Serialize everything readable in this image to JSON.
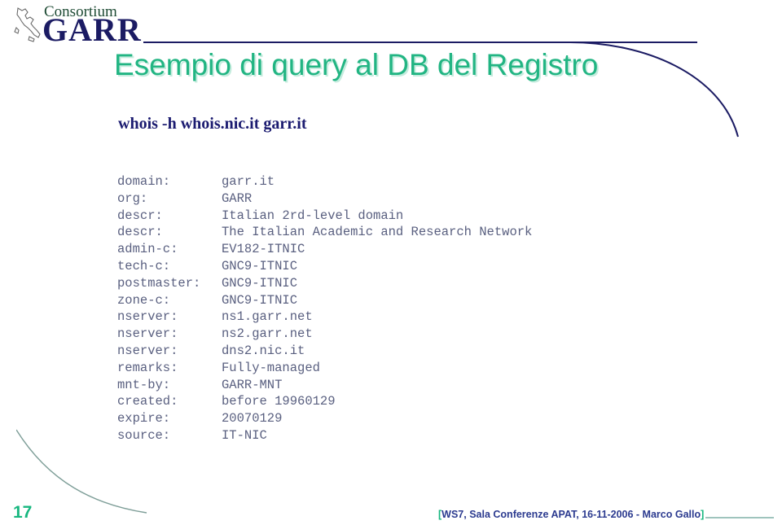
{
  "logo": {
    "map_icon": "italy-map-icon",
    "line1": "Consortium",
    "line2": "GARR",
    "green": "#1d4a33",
    "navy": "#1b1b63"
  },
  "slide": {
    "title": "Esempio di query al DB del Registro",
    "title_color": "#22b583",
    "command": "whois -h whois.nic.it garr.it",
    "command_color": "#1b1b70"
  },
  "record": {
    "text_color": "#5a6080",
    "rows": [
      {
        "key": "domain:",
        "value": "garr.it"
      },
      {
        "key": "org:",
        "value": "GARR"
      },
      {
        "key": "descr:",
        "value": "Italian 2rd-level domain"
      },
      {
        "key": "descr:",
        "value": "The Italian Academic and Research Network"
      },
      {
        "key": "admin-c:",
        "value": "EV182-ITNIC"
      },
      {
        "key": "tech-c:",
        "value": "GNC9-ITNIC"
      },
      {
        "key": "postmaster:",
        "value": "GNC9-ITNIC"
      },
      {
        "key": "zone-c:",
        "value": "GNC9-ITNIC"
      },
      {
        "key": "nserver:",
        "value": "ns1.garr.net"
      },
      {
        "key": "nserver:",
        "value": "ns2.garr.net"
      },
      {
        "key": "nserver:",
        "value": "dns2.nic.it"
      },
      {
        "key": "remarks:",
        "value": "Fully-managed"
      },
      {
        "key": "mnt-by:",
        "value": "GARR-MNT"
      },
      {
        "key": "created:",
        "value": "before 19960129"
      },
      {
        "key": "expire:",
        "value": "20070129"
      },
      {
        "key": "source:",
        "value": "IT-NIC"
      }
    ]
  },
  "footer": {
    "page_number": "17",
    "page_number_color": "#17b77f",
    "bracket_open": "[",
    "text": "WS7, Sala Conferenze APAT, 16-11-2006 - Marco Gallo",
    "bracket_close": "]",
    "text_color": "#2b3a8f",
    "bracket_color": "#17b77f"
  }
}
